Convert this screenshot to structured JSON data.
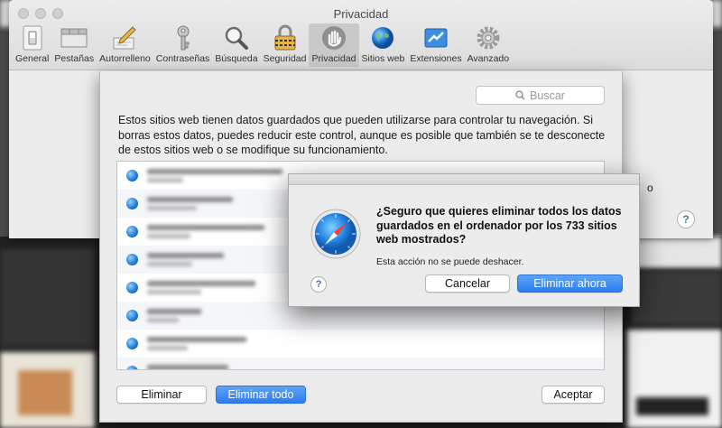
{
  "window": {
    "title": "Privacidad",
    "toolbar": [
      {
        "label": "General",
        "icon": "switch-icon"
      },
      {
        "label": "Pestañas",
        "icon": "tabs-icon"
      },
      {
        "label": "Autorrelleno",
        "icon": "pencil-icon"
      },
      {
        "label": "Contraseñas",
        "icon": "key-icon"
      },
      {
        "label": "Búsqueda",
        "icon": "magnifier-icon"
      },
      {
        "label": "Seguridad",
        "icon": "padlock-icon"
      },
      {
        "label": "Privacidad",
        "icon": "hand-icon",
        "active": true
      },
      {
        "label": "Sitios web",
        "icon": "globe-icon"
      },
      {
        "label": "Extensiones",
        "icon": "puzzle-icon"
      },
      {
        "label": "Avanzado",
        "icon": "gear-icon"
      }
    ],
    "help": "?",
    "partial_text": "o"
  },
  "sheet": {
    "search_placeholder": "Buscar",
    "description": "Estos sitios web tienen datos guardados que pueden utilizarse para controlar tu navegación. Si borras estos datos, puedes reducir este control, aunque es posible que también se te desconecte de estos sitios web o se modifique su funcionamiento.",
    "buttons": {
      "remove": "Eliminar",
      "remove_all": "Eliminar todo",
      "accept": "Aceptar"
    }
  },
  "alert": {
    "title": "¿Seguro que quieres eliminar todos los datos guardados en el ordenador por los 733 sitios web mostrados?",
    "message": "Esta acción no se puede deshacer.",
    "cancel": "Cancelar",
    "confirm": "Eliminar ahora",
    "help": "?"
  },
  "colors": {
    "accent": "#2b7cf1"
  }
}
